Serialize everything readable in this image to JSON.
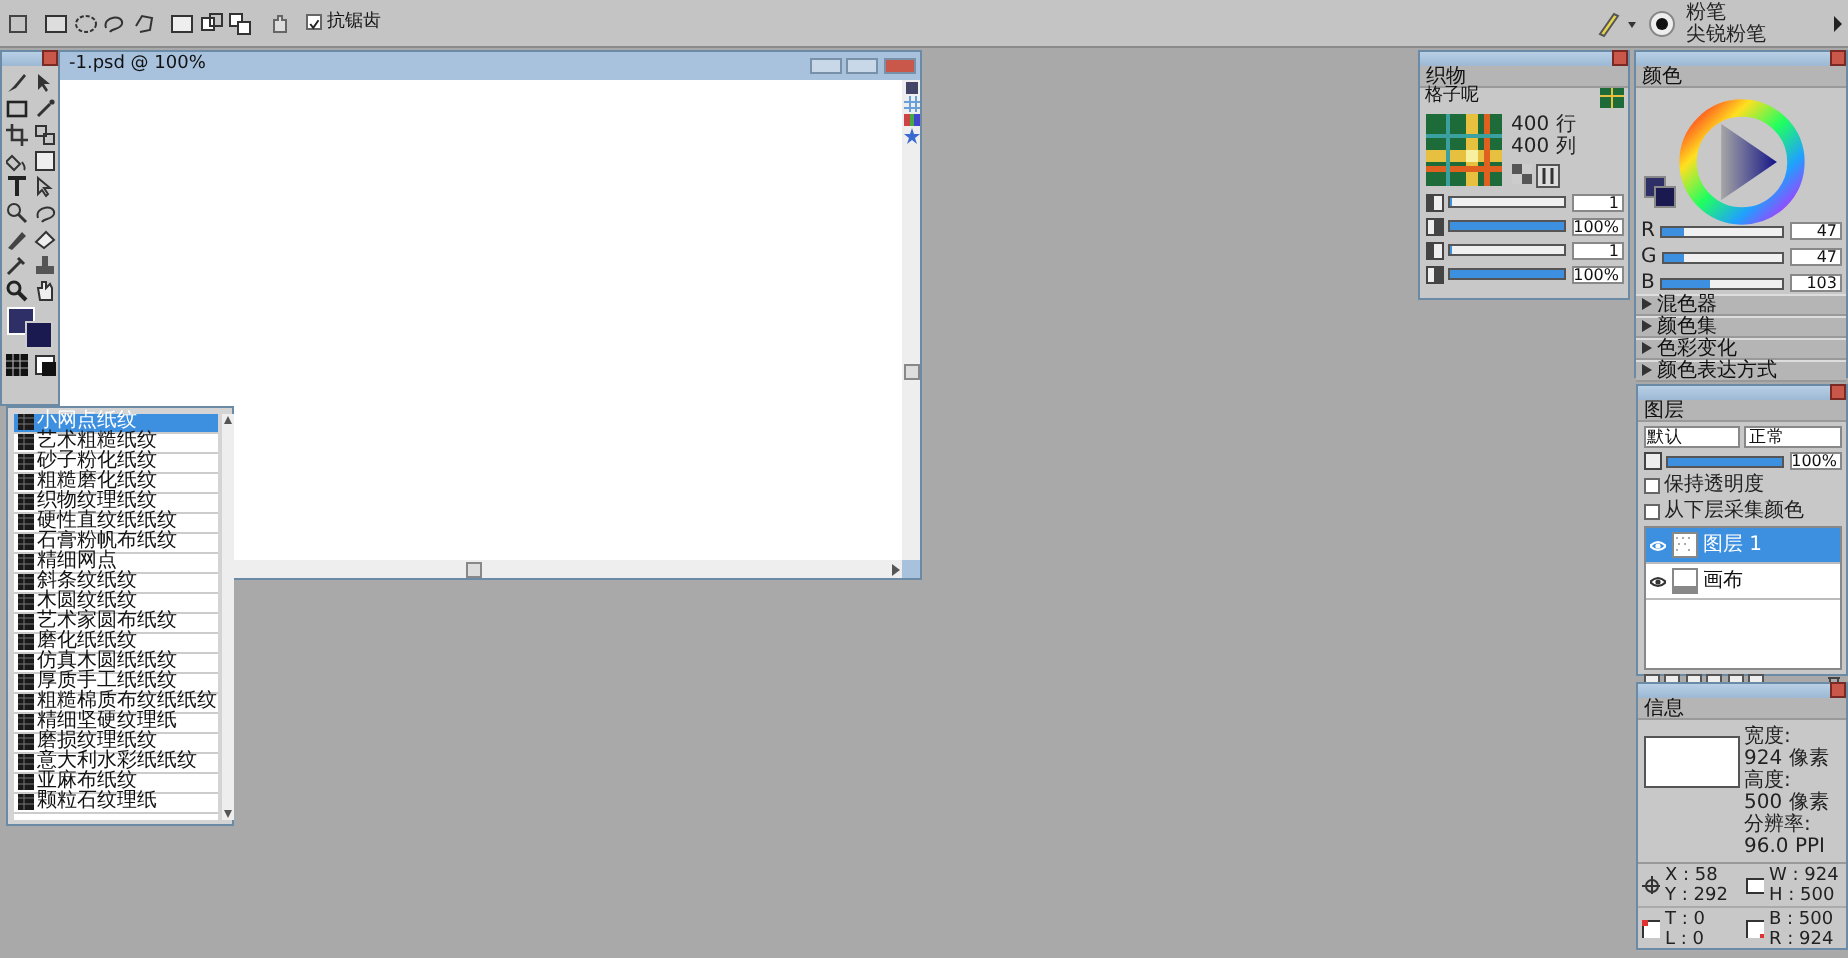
{
  "toolbar": {
    "antialias": {
      "label": "抗锯齿",
      "checked": true
    },
    "brush": {
      "category": "粉笔",
      "variant": "尖锐粉笔"
    }
  },
  "document": {
    "title": "-1.psd @ 100%"
  },
  "paper_list": {
    "items": [
      {
        "label": "小网点纸纹",
        "selected": true
      },
      {
        "label": "艺术粗糙纸纹",
        "selected": false
      },
      {
        "label": "砂子粉化纸纹",
        "selected": false
      },
      {
        "label": "粗糙磨化纸纹",
        "selected": false
      },
      {
        "label": "织物纹理纸纹",
        "selected": false
      },
      {
        "label": "硬性直纹纸纸纹",
        "selected": false
      },
      {
        "label": "石膏粉帆布纸纹",
        "selected": false
      },
      {
        "label": "精细网点",
        "selected": false
      },
      {
        "label": "斜条纹纸纹",
        "selected": false
      },
      {
        "label": "木圆纹纸纹",
        "selected": false
      },
      {
        "label": "艺术家圆布纸纹",
        "selected": false
      },
      {
        "label": "磨化纸纸纹",
        "selected": false
      },
      {
        "label": "仿真木圆纸纸纹",
        "selected": false
      },
      {
        "label": "厚质手工纸纸纹",
        "selected": false
      },
      {
        "label": "粗糙棉质布纹纸纸纹",
        "selected": false
      },
      {
        "label": "精细坚硬纹理纸",
        "selected": false
      },
      {
        "label": "磨损纹理纸纹",
        "selected": false
      },
      {
        "label": "意大利水彩纸纸纹",
        "selected": false
      },
      {
        "label": "亚麻布纸纹",
        "selected": false
      },
      {
        "label": "颗粒石纹理纸",
        "selected": false
      }
    ]
  },
  "weave_panel": {
    "title": "织物",
    "name": "格子呢",
    "rows": "400 行",
    "cols": "400 列",
    "sliders": [
      {
        "level": 0.02,
        "reading": "1"
      },
      {
        "level": 1,
        "reading": "100%"
      },
      {
        "level": 0.02,
        "reading": "1"
      },
      {
        "level": 1,
        "reading": "100%"
      }
    ]
  },
  "color_panel": {
    "title": "颜色",
    "channels": [
      {
        "name": "R",
        "level": 0.18,
        "reading": "47"
      },
      {
        "name": "G",
        "level": 0.18,
        "reading": "47"
      },
      {
        "name": "B",
        "level": 0.4,
        "reading": "103"
      }
    ],
    "sections": [
      "混色器",
      "颜色集",
      "色彩变化",
      "颜色表达方式"
    ]
  },
  "layers_panel": {
    "title": "图层",
    "composite_method": "默认",
    "composite_depth": "正常",
    "opacity": {
      "level": 1,
      "reading": "100%"
    },
    "options": [
      {
        "label": "保持透明度",
        "checked": false
      },
      {
        "label": "从下层采集颜色",
        "checked": false
      }
    ],
    "layers": [
      {
        "name": "图层 1",
        "kind": "layer",
        "selected": true
      },
      {
        "name": "画布",
        "kind": "canvas",
        "selected": false
      }
    ]
  },
  "info_panel": {
    "title": "信息",
    "width_label": "宽度:",
    "width": "924 像素",
    "height_label": "高度:",
    "height": "500 像素",
    "resolution_label": "分辨率:",
    "resolution": "96.0 PPI",
    "cells": [
      {
        "kind": "position",
        "lines": [
          "X : 58",
          "Y : 292"
        ]
      },
      {
        "kind": "size",
        "lines": [
          "W : 924",
          "H : 500"
        ]
      },
      {
        "kind": "topleft",
        "lines": [
          "T : 0",
          "L : 0"
        ]
      },
      {
        "kind": "bottomright",
        "lines": [
          "B : 500",
          "R : 924"
        ]
      }
    ]
  }
}
